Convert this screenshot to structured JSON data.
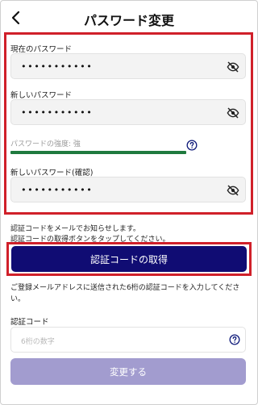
{
  "header": {
    "title": "パスワード変更",
    "back_icon": "chevron-left-icon"
  },
  "current_password": {
    "label": "現在のパスワード",
    "value": "•••••••••••",
    "toggle_icon": "eye-slash-icon"
  },
  "new_password": {
    "label": "新しいパスワード",
    "value": "•••••••••••",
    "toggle_icon": "eye-slash-icon"
  },
  "strength": {
    "label": "パスワードの強度: 強",
    "level": 1.0,
    "color": "#1f7a3e",
    "help_icon": "question-circle-icon"
  },
  "confirm_password": {
    "label": "新しいパスワード(確認)",
    "value": "•••••••••••",
    "toggle_icon": "eye-slash-icon"
  },
  "info": {
    "line1": "認証コードをメールでお知らせします。",
    "line2": "認証コードの取得ボタンをタップしてください。"
  },
  "get_code_button": {
    "label": "認証コードの取得",
    "color": "#100c73"
  },
  "description": "ご登録メールアドレスに送信された6桁の認証コードを入力してください。",
  "verification_code": {
    "label": "認証コード",
    "placeholder": "6桁の数字",
    "help_icon": "question-circle-icon"
  },
  "submit_button": {
    "label": "変更する",
    "color": "#a29ccf"
  },
  "highlight_color": "#d0202a"
}
